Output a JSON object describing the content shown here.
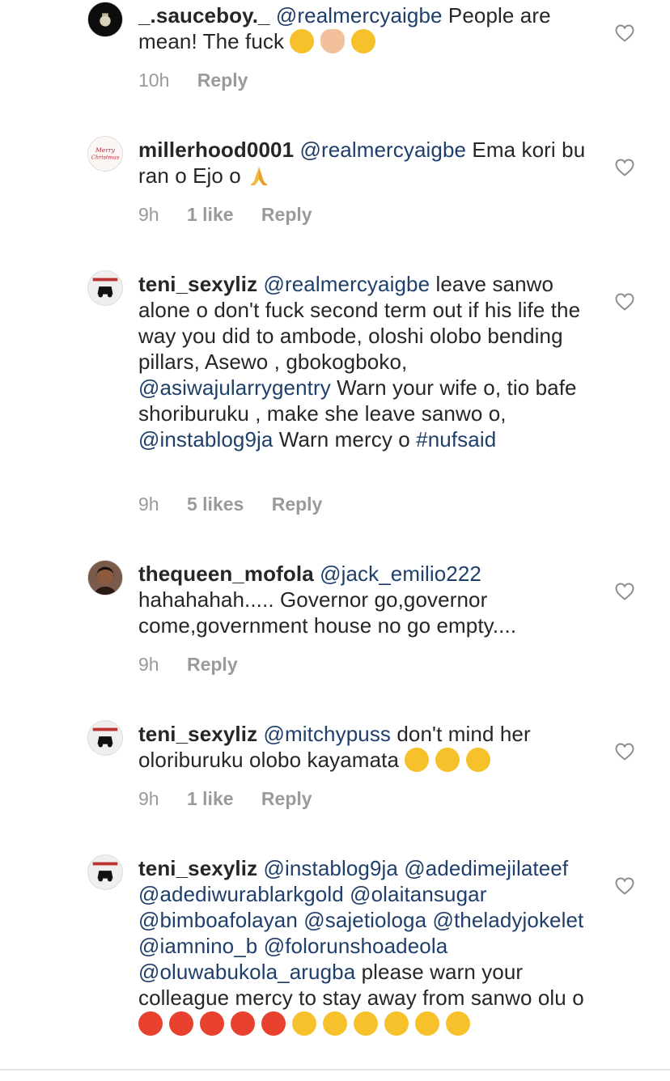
{
  "comments": [
    {
      "username": "_.sauceboy._",
      "segments": [
        {
          "t": "@realmercyaigbe",
          "m": true
        },
        {
          "t": " People are mean! The fuck ",
          "m": false
        }
      ],
      "emojis": [
        "laugh-icon",
        "facepalm-icon",
        "laugh-icon"
      ],
      "time": "10h",
      "likes": "",
      "reply": "Reply"
    },
    {
      "username": "millerhood0001",
      "segments": [
        {
          "t": "@realmercyaigbe",
          "m": true
        },
        {
          "t": " Ema kori bu ran o Ejo o ",
          "m": false
        }
      ],
      "emojis": [
        "pray-icon"
      ],
      "time": "9h",
      "likes": "1 like",
      "reply": "Reply"
    },
    {
      "username": "teni_sexyliz",
      "segments": [
        {
          "t": "@realmercyaigbe",
          "m": true
        },
        {
          "t": " leave sanwo alone o don't fuck second term out if his life the way you did to ambode, oloshi olobo bending pillars, Asewo , gbokogboko, ",
          "m": false
        },
        {
          "t": "@asiwajularrygentry",
          "m": true
        },
        {
          "t": " Warn your wife o, tio bafe shoriburuku , make she leave sanwo o, ",
          "m": false
        },
        {
          "t": "@instablog9ja",
          "m": true
        },
        {
          "t": " Warn mercy o ",
          "m": false
        },
        {
          "t": "#nufsaid",
          "m": true
        }
      ],
      "emojis": [],
      "time": "9h",
      "likes": "5 likes",
      "reply": "Reply"
    },
    {
      "username": "thequeen_mofola",
      "segments": [
        {
          "t": "@jack_emilio222",
          "m": true
        },
        {
          "t": " hahahahah..... Governor go,governor come,government house no go empty....",
          "m": false
        }
      ],
      "emojis": [],
      "time": "9h",
      "likes": "",
      "reply": "Reply"
    },
    {
      "username": "teni_sexyliz",
      "segments": [
        {
          "t": "@mitchypuss",
          "m": true
        },
        {
          "t": " don't mind her oloriburuku olobo kayamata ",
          "m": false
        }
      ],
      "emojis": [
        "smirk-icon",
        "smirk-icon",
        "smirk-icon"
      ],
      "time": "9h",
      "likes": "1 like",
      "reply": "Reply"
    },
    {
      "username": "teni_sexyliz",
      "segments": [
        {
          "t": "@instablog9ja",
          "m": true
        },
        {
          "t": " ",
          "m": false
        },
        {
          "t": "@adedimejilateef",
          "m": true
        },
        {
          "t": " ",
          "m": false
        },
        {
          "t": "@adediwurablarkgold",
          "m": true
        },
        {
          "t": " ",
          "m": false
        },
        {
          "t": "@olaitansugar",
          "m": true
        },
        {
          "t": " ",
          "m": false
        },
        {
          "t": "@bimboafolayan",
          "m": true
        },
        {
          "t": " ",
          "m": false
        },
        {
          "t": "@sajetiologa",
          "m": true
        },
        {
          "t": "  ",
          "m": false
        },
        {
          "t": "@theladyjokelet",
          "m": true
        },
        {
          "t": " ",
          "m": false
        },
        {
          "t": "@iamnino_b",
          "m": true
        },
        {
          "t": " ",
          "m": false
        },
        {
          "t": "@folorunshoadeola",
          "m": true
        },
        {
          "t": " ",
          "m": false
        },
        {
          "t": "@oluwabukola_arugba",
          "m": true
        },
        {
          "t": " please warn your colleague mercy to stay away from sanwo olu o ",
          "m": false
        }
      ],
      "emojis": [
        "angry-icon",
        "angry-icon",
        "angry-icon",
        "angry-icon",
        "angry-icon",
        "grimace-icon",
        "grimace-icon",
        "grimace-icon",
        "grimace-icon",
        "grimace-icon",
        "grimace-icon"
      ],
      "time": "",
      "likes": "",
      "reply": ""
    }
  ],
  "colors": {
    "text": "#262626",
    "mention": "#1f3f6b",
    "meta": "#9a9a9a"
  }
}
